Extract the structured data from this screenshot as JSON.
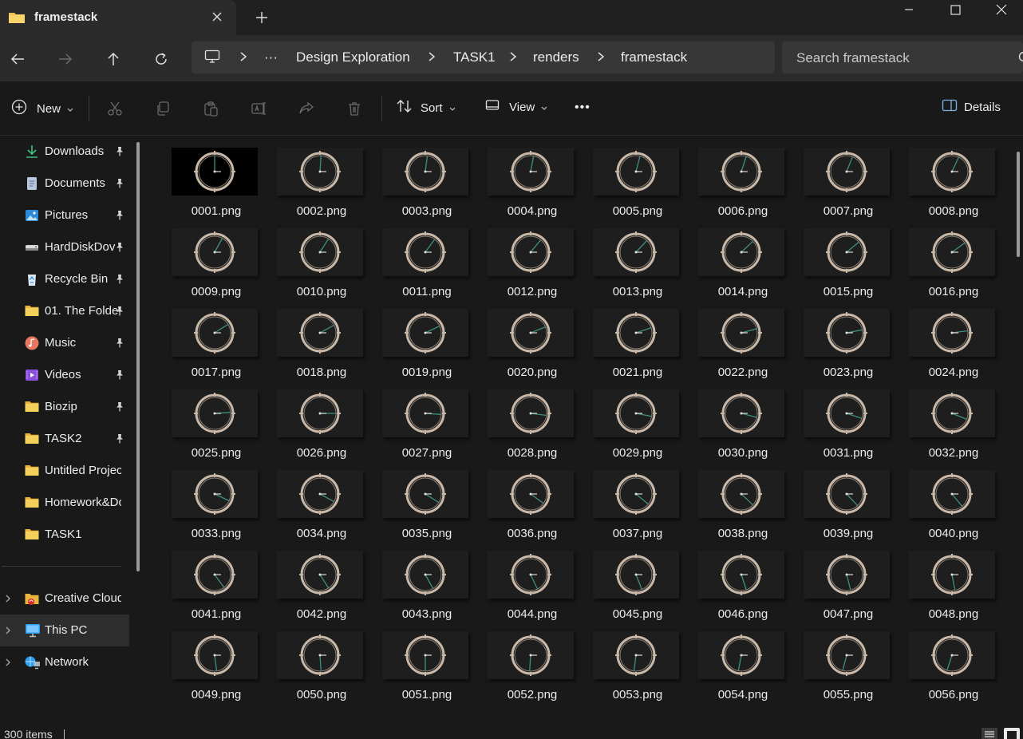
{
  "window": {
    "tab_title": "framestack",
    "controls": [
      "minimize-icon",
      "maximize-icon",
      "close-icon"
    ]
  },
  "address": {
    "crumbs": [
      "Design Exploration",
      "TASK1",
      "renders",
      "framestack"
    ],
    "overflow": "···",
    "search_placeholder": "Search framestack"
  },
  "toolbar": {
    "new_label": "New",
    "sort_label": "Sort",
    "view_label": "View",
    "more_label": "•••",
    "details_label": "Details"
  },
  "sidebar": {
    "quick_access": [
      {
        "label": "Downloads",
        "icon": "download-icon",
        "pinned": true
      },
      {
        "label": "Documents",
        "icon": "document-icon",
        "pinned": true
      },
      {
        "label": "Pictures",
        "icon": "picture-icon",
        "pinned": true
      },
      {
        "label": "HardDiskDov",
        "icon": "drive-icon",
        "pinned": true
      },
      {
        "label": "Recycle Bin",
        "icon": "recycle-bin-icon",
        "pinned": true
      },
      {
        "label": "01. The Folde",
        "icon": "folder-icon",
        "pinned": true
      },
      {
        "label": "Music",
        "icon": "music-icon",
        "pinned": true
      },
      {
        "label": "Videos",
        "icon": "video-icon",
        "pinned": true
      },
      {
        "label": "Biozip",
        "icon": "folder-icon",
        "pinned": true
      },
      {
        "label": "TASK2",
        "icon": "folder-icon",
        "pinned": true
      },
      {
        "label": "Untitled Project_",
        "icon": "folder-icon",
        "pinned": false
      },
      {
        "label": "Homework&Do",
        "icon": "folder-icon",
        "pinned": false
      },
      {
        "label": "TASK1",
        "icon": "folder-icon",
        "pinned": false
      }
    ],
    "locations": [
      {
        "label": "Creative Cloud F",
        "icon": "creative-cloud-icon",
        "selected": false
      },
      {
        "label": "This PC",
        "icon": "computer-icon",
        "selected": true
      },
      {
        "label": "Network",
        "icon": "network-icon",
        "selected": false
      }
    ]
  },
  "files": [
    "0001.png",
    "0002.png",
    "0003.png",
    "0004.png",
    "0005.png",
    "0006.png",
    "0007.png",
    "0008.png",
    "0009.png",
    "0010.png",
    "0011.png",
    "0012.png",
    "0013.png",
    "0014.png",
    "0015.png",
    "0016.png",
    "0017.png",
    "0018.png",
    "0019.png",
    "0020.png",
    "0021.png",
    "0022.png",
    "0023.png",
    "0024.png",
    "0025.png",
    "0026.png",
    "0027.png",
    "0028.png",
    "0029.png",
    "0030.png",
    "0031.png",
    "0032.png",
    "0033.png",
    "0034.png",
    "0035.png",
    "0036.png",
    "0037.png",
    "0038.png",
    "0039.png",
    "0040.png",
    "0041.png",
    "0042.png",
    "0043.png",
    "0044.png",
    "0045.png",
    "0046.png",
    "0047.png",
    "0048.png",
    "0049.png",
    "0050.png",
    "0051.png",
    "0052.png",
    "0053.png",
    "0054.png",
    "0055.png",
    "0056.png"
  ],
  "status": {
    "item_count": "300 items"
  },
  "colors": {
    "background": "#191919",
    "chrome": "#2b2b2b",
    "folder": "#f2c34e",
    "clock_ring": "#c9b8a8",
    "clock_hand": "#3d8f7f"
  }
}
